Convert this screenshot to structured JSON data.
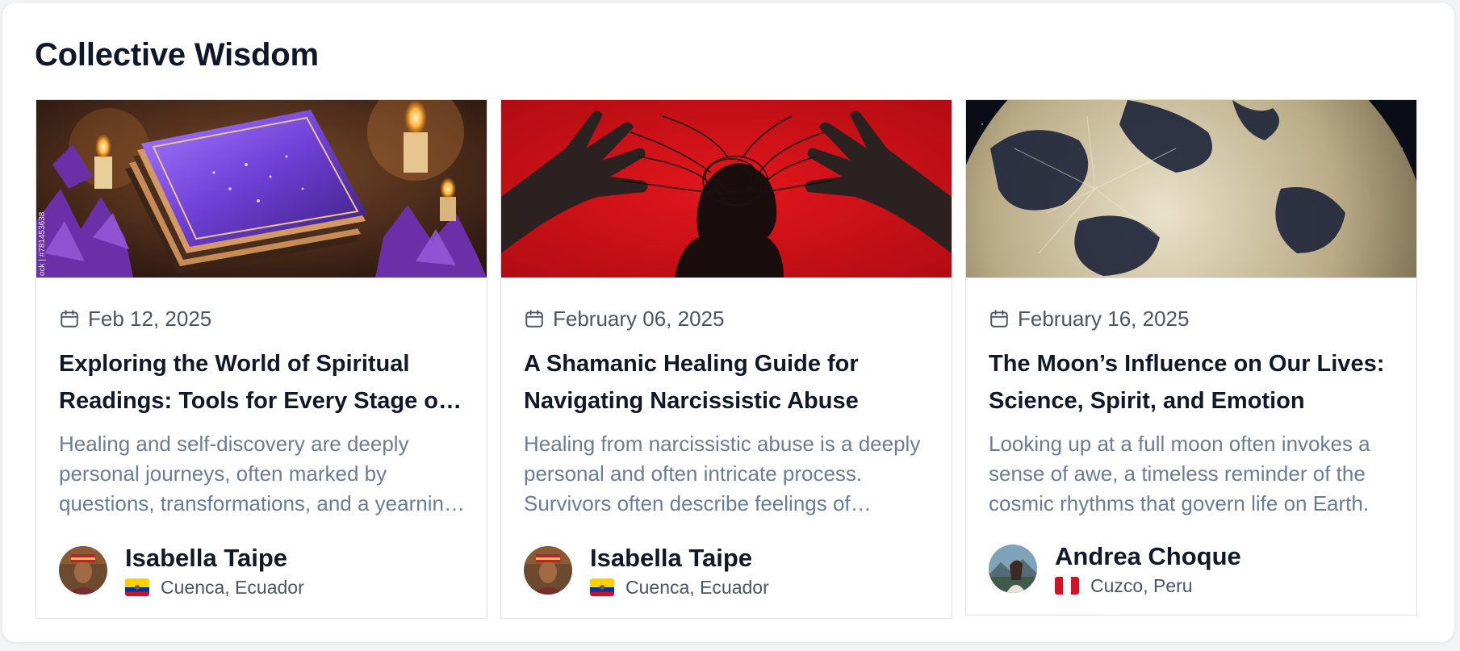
{
  "section": {
    "title": "Collective Wisdom"
  },
  "posts": [
    {
      "date": "Feb 12, 2025",
      "title": "Exploring the World of Spiritual Readings: Tools for Every Stage of Life",
      "excerpt": "Healing and self-discovery are deeply personal journeys, often marked by questions, transformations, and a yearning for guidance.",
      "image_watermark": "ock | #781453638",
      "author": {
        "name": "Isabella Taipe",
        "location": "Cuenca, Ecuador",
        "flag": "ecuador"
      }
    },
    {
      "date": "February 06, 2025",
      "title": "A Shamanic Healing Guide for Navigating Narcissistic Abuse",
      "excerpt": "Healing from narcissistic abuse is a deeply personal and often intricate process. Survivors often describe feelings of confusion.",
      "author": {
        "name": "Isabella Taipe",
        "location": "Cuenca, Ecuador",
        "flag": "ecuador"
      }
    },
    {
      "date": "February 16, 2025",
      "title": "The Moon’s Influence on Our Lives: Science, Spirit, and Emotion",
      "excerpt": "Looking up at a full moon often invokes a sense of awe, a timeless reminder of the cosmic rhythms that govern life on Earth.",
      "author": {
        "name": "Andrea Choque",
        "location": "Cuzco, Peru",
        "flag": "peru"
      }
    }
  ],
  "icons": {
    "date": "calendar-icon"
  },
  "colors": {
    "title": "#111827",
    "excerpt": "#6b7c93",
    "date": "#4b5563",
    "border": "#dfe3e8"
  }
}
